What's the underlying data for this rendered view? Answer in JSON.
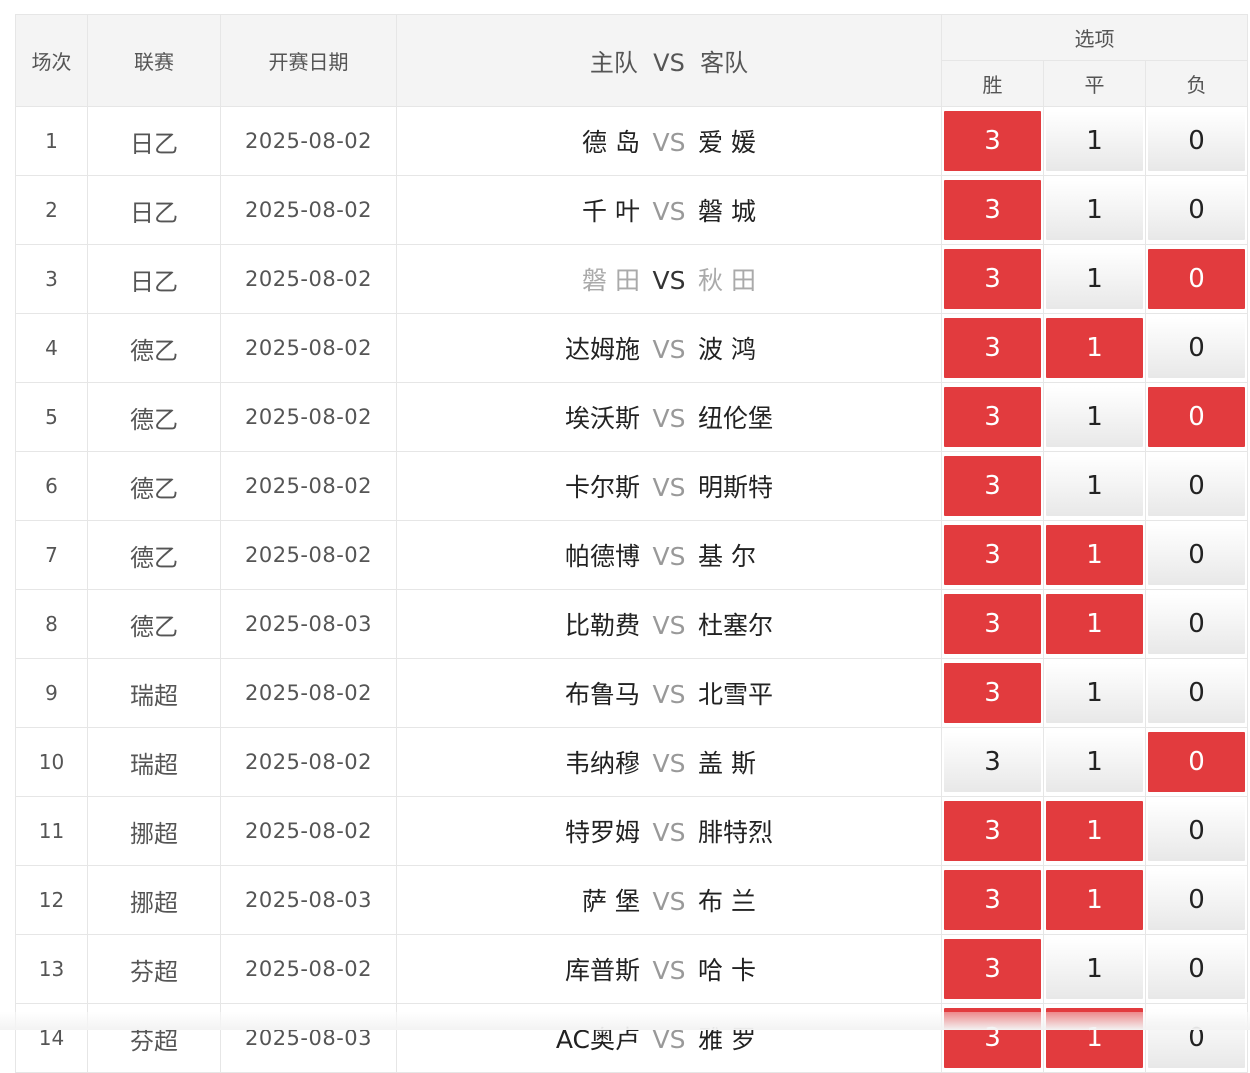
{
  "header": {
    "no": "场次",
    "league": "联赛",
    "date": "开赛日期",
    "matchup_home": "主队",
    "matchup_vs": "VS",
    "matchup_away": "客队",
    "options": "选项",
    "win": "胜",
    "draw": "平",
    "loss": "负"
  },
  "accent_color": "#e23b3e",
  "rows": [
    {
      "no": "1",
      "league": "日乙",
      "date": "2025-08-02",
      "home": "德 岛",
      "vs": "VS",
      "away": "爱 媛",
      "win": "3",
      "draw": "1",
      "loss": "0",
      "sel": [
        true,
        false,
        false
      ],
      "dim": false
    },
    {
      "no": "2",
      "league": "日乙",
      "date": "2025-08-02",
      "home": "千 叶",
      "vs": "VS",
      "away": "磐 城",
      "win": "3",
      "draw": "1",
      "loss": "0",
      "sel": [
        true,
        false,
        false
      ],
      "dim": false
    },
    {
      "no": "3",
      "league": "日乙",
      "date": "2025-08-02",
      "home": "磐 田",
      "vs": "VS",
      "away": "秋 田",
      "win": "3",
      "draw": "1",
      "loss": "0",
      "sel": [
        true,
        false,
        true
      ],
      "dim": true
    },
    {
      "no": "4",
      "league": "德乙",
      "date": "2025-08-02",
      "home": "达姆施",
      "vs": "VS",
      "away": "波 鸿",
      "win": "3",
      "draw": "1",
      "loss": "0",
      "sel": [
        true,
        true,
        false
      ],
      "dim": false
    },
    {
      "no": "5",
      "league": "德乙",
      "date": "2025-08-02",
      "home": "埃沃斯",
      "vs": "VS",
      "away": "纽伦堡",
      "win": "3",
      "draw": "1",
      "loss": "0",
      "sel": [
        true,
        false,
        true
      ],
      "dim": false
    },
    {
      "no": "6",
      "league": "德乙",
      "date": "2025-08-02",
      "home": "卡尔斯",
      "vs": "VS",
      "away": "明斯特",
      "win": "3",
      "draw": "1",
      "loss": "0",
      "sel": [
        true,
        false,
        false
      ],
      "dim": false
    },
    {
      "no": "7",
      "league": "德乙",
      "date": "2025-08-02",
      "home": "帕德博",
      "vs": "VS",
      "away": "基 尔",
      "win": "3",
      "draw": "1",
      "loss": "0",
      "sel": [
        true,
        true,
        false
      ],
      "dim": false
    },
    {
      "no": "8",
      "league": "德乙",
      "date": "2025-08-03",
      "home": "比勒费",
      "vs": "VS",
      "away": "杜塞尔",
      "win": "3",
      "draw": "1",
      "loss": "0",
      "sel": [
        true,
        true,
        false
      ],
      "dim": false
    },
    {
      "no": "9",
      "league": "瑞超",
      "date": "2025-08-02",
      "home": "布鲁马",
      "vs": "VS",
      "away": "北雪平",
      "win": "3",
      "draw": "1",
      "loss": "0",
      "sel": [
        true,
        false,
        false
      ],
      "dim": false
    },
    {
      "no": "10",
      "league": "瑞超",
      "date": "2025-08-02",
      "home": "韦纳穆",
      "vs": "VS",
      "away": "盖 斯",
      "win": "3",
      "draw": "1",
      "loss": "0",
      "sel": [
        false,
        false,
        true
      ],
      "dim": false
    },
    {
      "no": "11",
      "league": "挪超",
      "date": "2025-08-02",
      "home": "特罗姆",
      "vs": "VS",
      "away": "腓特烈",
      "win": "3",
      "draw": "1",
      "loss": "0",
      "sel": [
        true,
        true,
        false
      ],
      "dim": false
    },
    {
      "no": "12",
      "league": "挪超",
      "date": "2025-08-03",
      "home": "萨 堡",
      "vs": "VS",
      "away": "布 兰",
      "win": "3",
      "draw": "1",
      "loss": "0",
      "sel": [
        true,
        true,
        false
      ],
      "dim": false
    },
    {
      "no": "13",
      "league": "芬超",
      "date": "2025-08-02",
      "home": "库普斯",
      "vs": "VS",
      "away": "哈 卡",
      "win": "3",
      "draw": "1",
      "loss": "0",
      "sel": [
        true,
        false,
        false
      ],
      "dim": false
    },
    {
      "no": "14",
      "league": "芬超",
      "date": "2025-08-03",
      "home": "AC奥卢",
      "vs": "VS",
      "away": "雅 罗",
      "win": "3",
      "draw": "1",
      "loss": "0",
      "sel": [
        true,
        true,
        false
      ],
      "dim": false
    }
  ]
}
